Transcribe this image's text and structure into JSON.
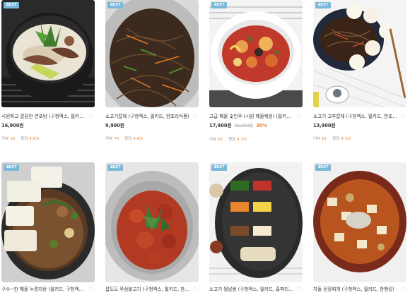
{
  "products": [
    {
      "badge": "BEST",
      "title": "시원하고 깔끔한 연포탕 (구청맥스, 필키드, 한...",
      "price": "16,900원",
      "review_label": "리뷰",
      "review_count": "26",
      "rating_label": "평점",
      "rating": "4.6/5",
      "icon": "heart-icon"
    },
    {
      "badge": "BEST",
      "title": "소고기잡채 (구청맥스, 필키드, 한조리식품)",
      "price": "9,900원",
      "review_label": "리뷰",
      "review_count": "74",
      "rating_label": "평점",
      "rating": "4.6/5",
      "icon": "heart-icon"
    },
    {
      "badge": "BEST",
      "title": "고급 해물 숯안주 (시원 해물볶음) (필키드, 구...",
      "price": "17,900원",
      "orig_price": "25,900원",
      "discount": "30%",
      "review_label": "리뷰",
      "review_count": "67",
      "rating_label": "평점",
      "rating": "4.7/5",
      "icon": "heart-icon"
    },
    {
      "badge": "BEST",
      "title": "소고기 고추잡채 (구청맥스, 필키드, 한조리식품)",
      "price": "13,900원",
      "review_label": "리뷰",
      "review_count": "81",
      "rating_label": "평점",
      "rating": "4.7/5",
      "icon": "heart-icon"
    },
    {
      "badge": "BEST",
      "title": "구수~한 해물 누룽지탕 (필키드, 구청맥스, 한조...",
      "icon": "heart-icon"
    },
    {
      "badge": "BEST",
      "title": "팝도도 쭈삼불고기 (구청맥스, 필키드, 한조리식...",
      "icon": "heart-icon"
    },
    {
      "badge": "BEST",
      "title": "소고기 월남쌈 (구청맥스, 필키드, 홈파티음식)",
      "icon": "heart-icon"
    },
    {
      "badge": "BEST",
      "title": "차돌 된장찌개 (구청맥스, 필키드, 한뱅킷)",
      "icon": "heart-icon"
    }
  ],
  "colors": {
    "badge": "#79b8d9",
    "accent": "#e8883b"
  }
}
